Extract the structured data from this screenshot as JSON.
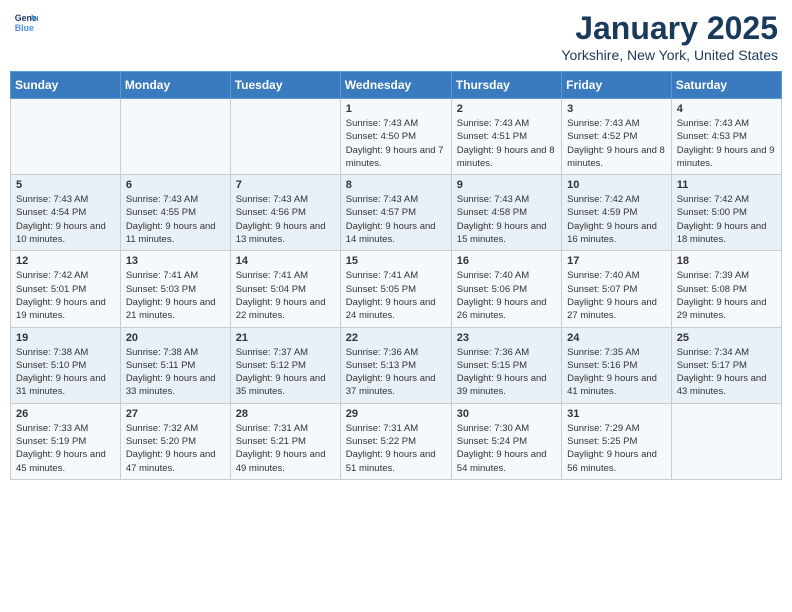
{
  "header": {
    "logo_line1": "General",
    "logo_line2": "Blue",
    "title": "January 2025",
    "subtitle": "Yorkshire, New York, United States"
  },
  "days_of_week": [
    "Sunday",
    "Monday",
    "Tuesday",
    "Wednesday",
    "Thursday",
    "Friday",
    "Saturday"
  ],
  "weeks": [
    [
      {
        "day": "",
        "info": ""
      },
      {
        "day": "",
        "info": ""
      },
      {
        "day": "",
        "info": ""
      },
      {
        "day": "1",
        "info": "Sunrise: 7:43 AM\nSunset: 4:50 PM\nDaylight: 9 hours and 7 minutes."
      },
      {
        "day": "2",
        "info": "Sunrise: 7:43 AM\nSunset: 4:51 PM\nDaylight: 9 hours and 8 minutes."
      },
      {
        "day": "3",
        "info": "Sunrise: 7:43 AM\nSunset: 4:52 PM\nDaylight: 9 hours and 8 minutes."
      },
      {
        "day": "4",
        "info": "Sunrise: 7:43 AM\nSunset: 4:53 PM\nDaylight: 9 hours and 9 minutes."
      }
    ],
    [
      {
        "day": "5",
        "info": "Sunrise: 7:43 AM\nSunset: 4:54 PM\nDaylight: 9 hours and 10 minutes."
      },
      {
        "day": "6",
        "info": "Sunrise: 7:43 AM\nSunset: 4:55 PM\nDaylight: 9 hours and 11 minutes."
      },
      {
        "day": "7",
        "info": "Sunrise: 7:43 AM\nSunset: 4:56 PM\nDaylight: 9 hours and 13 minutes."
      },
      {
        "day": "8",
        "info": "Sunrise: 7:43 AM\nSunset: 4:57 PM\nDaylight: 9 hours and 14 minutes."
      },
      {
        "day": "9",
        "info": "Sunrise: 7:43 AM\nSunset: 4:58 PM\nDaylight: 9 hours and 15 minutes."
      },
      {
        "day": "10",
        "info": "Sunrise: 7:42 AM\nSunset: 4:59 PM\nDaylight: 9 hours and 16 minutes."
      },
      {
        "day": "11",
        "info": "Sunrise: 7:42 AM\nSunset: 5:00 PM\nDaylight: 9 hours and 18 minutes."
      }
    ],
    [
      {
        "day": "12",
        "info": "Sunrise: 7:42 AM\nSunset: 5:01 PM\nDaylight: 9 hours and 19 minutes."
      },
      {
        "day": "13",
        "info": "Sunrise: 7:41 AM\nSunset: 5:03 PM\nDaylight: 9 hours and 21 minutes."
      },
      {
        "day": "14",
        "info": "Sunrise: 7:41 AM\nSunset: 5:04 PM\nDaylight: 9 hours and 22 minutes."
      },
      {
        "day": "15",
        "info": "Sunrise: 7:41 AM\nSunset: 5:05 PM\nDaylight: 9 hours and 24 minutes."
      },
      {
        "day": "16",
        "info": "Sunrise: 7:40 AM\nSunset: 5:06 PM\nDaylight: 9 hours and 26 minutes."
      },
      {
        "day": "17",
        "info": "Sunrise: 7:40 AM\nSunset: 5:07 PM\nDaylight: 9 hours and 27 minutes."
      },
      {
        "day": "18",
        "info": "Sunrise: 7:39 AM\nSunset: 5:08 PM\nDaylight: 9 hours and 29 minutes."
      }
    ],
    [
      {
        "day": "19",
        "info": "Sunrise: 7:38 AM\nSunset: 5:10 PM\nDaylight: 9 hours and 31 minutes."
      },
      {
        "day": "20",
        "info": "Sunrise: 7:38 AM\nSunset: 5:11 PM\nDaylight: 9 hours and 33 minutes."
      },
      {
        "day": "21",
        "info": "Sunrise: 7:37 AM\nSunset: 5:12 PM\nDaylight: 9 hours and 35 minutes."
      },
      {
        "day": "22",
        "info": "Sunrise: 7:36 AM\nSunset: 5:13 PM\nDaylight: 9 hours and 37 minutes."
      },
      {
        "day": "23",
        "info": "Sunrise: 7:36 AM\nSunset: 5:15 PM\nDaylight: 9 hours and 39 minutes."
      },
      {
        "day": "24",
        "info": "Sunrise: 7:35 AM\nSunset: 5:16 PM\nDaylight: 9 hours and 41 minutes."
      },
      {
        "day": "25",
        "info": "Sunrise: 7:34 AM\nSunset: 5:17 PM\nDaylight: 9 hours and 43 minutes."
      }
    ],
    [
      {
        "day": "26",
        "info": "Sunrise: 7:33 AM\nSunset: 5:19 PM\nDaylight: 9 hours and 45 minutes."
      },
      {
        "day": "27",
        "info": "Sunrise: 7:32 AM\nSunset: 5:20 PM\nDaylight: 9 hours and 47 minutes."
      },
      {
        "day": "28",
        "info": "Sunrise: 7:31 AM\nSunset: 5:21 PM\nDaylight: 9 hours and 49 minutes."
      },
      {
        "day": "29",
        "info": "Sunrise: 7:31 AM\nSunset: 5:22 PM\nDaylight: 9 hours and 51 minutes."
      },
      {
        "day": "30",
        "info": "Sunrise: 7:30 AM\nSunset: 5:24 PM\nDaylight: 9 hours and 54 minutes."
      },
      {
        "day": "31",
        "info": "Sunrise: 7:29 AM\nSunset: 5:25 PM\nDaylight: 9 hours and 56 minutes."
      },
      {
        "day": "",
        "info": ""
      }
    ]
  ]
}
